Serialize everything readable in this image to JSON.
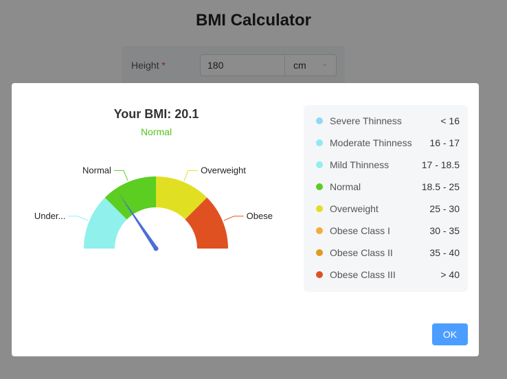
{
  "app": {
    "title": "BMI Calculator"
  },
  "form": {
    "height_label": "Height",
    "required_mark": "*",
    "height_value": "180",
    "unit_value": "cm"
  },
  "modal": {
    "bmi_text": "Your BMI: 20.1",
    "category": "Normal",
    "ok_label": "OK"
  },
  "gauge": {
    "value": 20.1,
    "segments": [
      {
        "label": "Under...",
        "color": "#8ff0ec"
      },
      {
        "label": "Normal",
        "color": "#5ccd21"
      },
      {
        "label": "Overweight",
        "color": "#e1df22"
      },
      {
        "label": "Obese",
        "color": "#e05122"
      }
    ],
    "needle_color": "#4c6ed6"
  },
  "legend": [
    {
      "name": "Severe Thinness",
      "range": "< 16",
      "color": "#8fd8f5"
    },
    {
      "name": "Moderate Thinness",
      "range": "16 - 17",
      "color": "#92e9f5"
    },
    {
      "name": "Mild Thinness",
      "range": "17 - 18.5",
      "color": "#8ff0ec"
    },
    {
      "name": "Normal",
      "range": "18.5 - 25",
      "color": "#5ccd21"
    },
    {
      "name": "Overweight",
      "range": "25 - 30",
      "color": "#e1df22"
    },
    {
      "name": "Obese Class I",
      "range": "30 - 35",
      "color": "#f0ad3d"
    },
    {
      "name": "Obese Class II",
      "range": "35 - 40",
      "color": "#e29a1f"
    },
    {
      "name": "Obese Class III",
      "range": "> 40",
      "color": "#e05122"
    }
  ]
}
